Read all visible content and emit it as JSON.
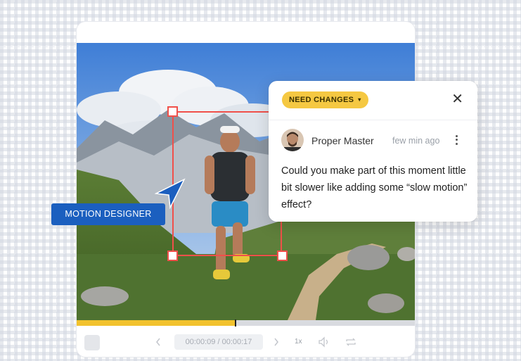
{
  "player": {
    "time": "00:00:09 / 00:00:17",
    "speed": "1x",
    "progress": 0.47,
    "icons": {
      "prev": "chevron-left-icon",
      "next": "chevron-right-icon",
      "volume": "volume-icon",
      "loop": "repeat-icon"
    }
  },
  "collaborator": {
    "label": "MOTION DESIGNER"
  },
  "comment": {
    "status": "NEED CHANGES",
    "author": "Proper Master",
    "time": "few min ago",
    "text": "Could you make part of this moment little bit slower like adding some “slow motion” effect?"
  },
  "colors": {
    "selection": "#f0504a",
    "badge": "#1b5fbf",
    "status": "#f5c842",
    "progress": "#f2c22e"
  }
}
